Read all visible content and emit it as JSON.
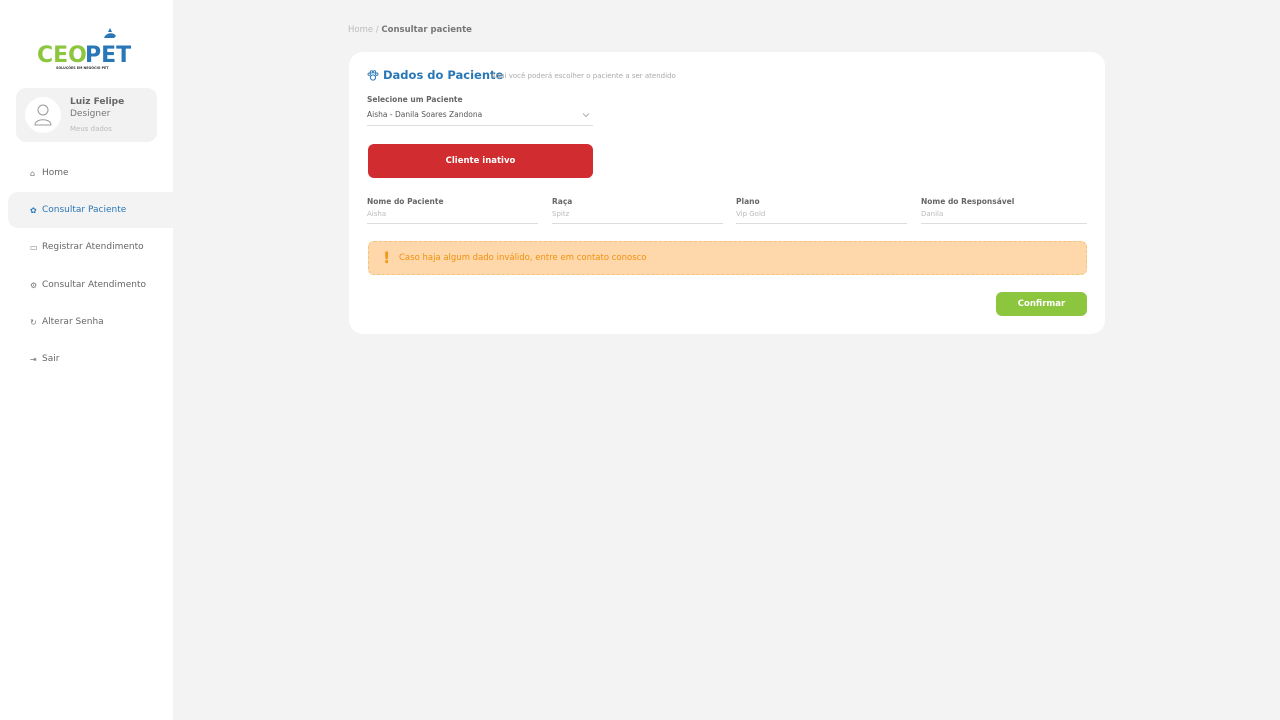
{
  "brand": {
    "logo_text_a": "CEO",
    "logo_text_b": "PET",
    "logo_tagline": "SOLUÇÕES EM NEGÓCIO PET",
    "colors": {
      "green": "#8cc63f",
      "blue": "#2a77b7",
      "red": "#d12c30",
      "warning_bg": "#fed8ab",
      "warning_text": "#f0900c"
    }
  },
  "user": {
    "name": "Luiz Felipe",
    "role": "Designer",
    "link": "Meus dados"
  },
  "nav": {
    "items": [
      {
        "label": "Home",
        "icon": "home-icon"
      },
      {
        "label": "Consultar Paciente",
        "icon": "paw-icon",
        "active": true
      },
      {
        "label": "Registrar Atendimento",
        "icon": "folder-icon"
      },
      {
        "label": "Consultar Atendimento",
        "icon": "gear-icon"
      },
      {
        "label": "Alterar Senha",
        "icon": "refresh-icon"
      },
      {
        "label": "Sair",
        "icon": "logout-icon"
      }
    ]
  },
  "breadcrumb": {
    "home": "Home",
    "separator": " / ",
    "current": "Consultar paciente"
  },
  "card": {
    "title": "Dados do Paciente",
    "subtitle": "Aqui você poderá escolher o paciente a ser atendido",
    "select_label": "Selecione um Paciente",
    "select_value": "Aisha - Danila Soares Zandona",
    "inactive_label": "Cliente inativo",
    "fields": [
      {
        "label": "Nome do Paciente",
        "value": "Aisha"
      },
      {
        "label": "Raça",
        "value": "Spitz"
      },
      {
        "label": "Plano",
        "value": "Vip Gold"
      },
      {
        "label": "Nome do Responsável",
        "value": "Danila"
      }
    ],
    "alert_icon": "!",
    "alert_text": "Caso haja algum dado inválido, entre em contato conosco",
    "confirm_label": "Confirmar"
  }
}
